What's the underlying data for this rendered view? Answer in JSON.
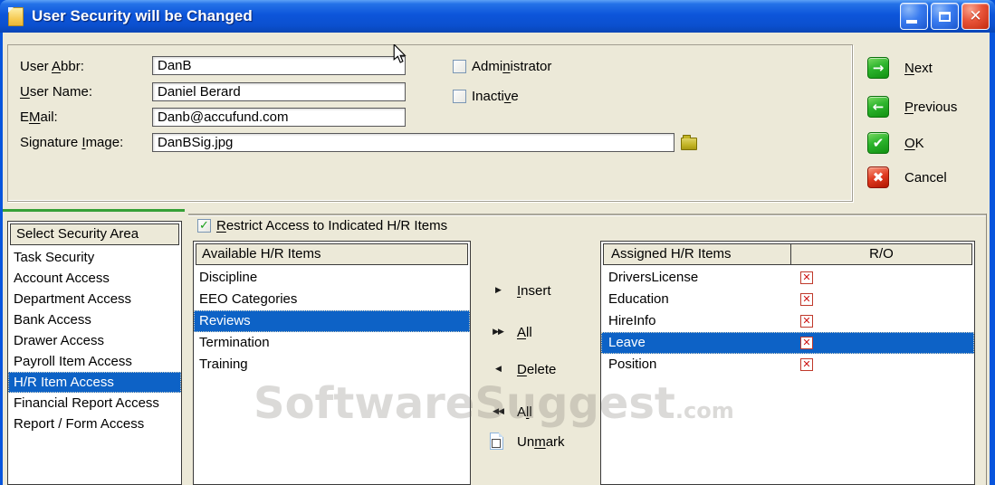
{
  "window": {
    "title": "User Security will be Changed",
    "title_icon": "document-icon",
    "controls": [
      {
        "name": "minimize",
        "icon": "minimize-icon"
      },
      {
        "name": "maximize",
        "icon": "maximize-icon"
      },
      {
        "name": "close",
        "icon": "close-icon",
        "glyph": "✕"
      }
    ]
  },
  "user_form": {
    "fields": [
      {
        "label": "User &Abbr:",
        "value": "DanB"
      },
      {
        "label": "&User Name:",
        "value": "Daniel Berard"
      },
      {
        "label": "E&Mail:",
        "value": "Danb@accufund.com"
      },
      {
        "label": "Signature &Image:",
        "value": "DanBSig.jpg",
        "browse_icon": "folder-icon"
      }
    ],
    "checkboxes": [
      {
        "label": "Admi&nistrator",
        "checked": false
      },
      {
        "label": "Inacti&ve",
        "checked": false
      }
    ]
  },
  "nav_buttons": [
    {
      "label": "&Next",
      "glyph": "→",
      "color": "#1FA51F"
    },
    {
      "label": "&Previous",
      "glyph": "←",
      "color": "#1FA51F"
    },
    {
      "label": "&OK",
      "glyph": "✔",
      "color": "#1FA51F"
    },
    {
      "label": "Cancel",
      "glyph": "✖",
      "color": "#D42A10"
    }
  ],
  "security_area_list": {
    "header": "Select Security Area",
    "items": [
      {
        "label": "Task Security"
      },
      {
        "label": "Account Access"
      },
      {
        "label": "Department Access"
      },
      {
        "label": "Bank Access"
      },
      {
        "label": "Drawer Access"
      },
      {
        "label": "Payroll Item Access"
      },
      {
        "label": "H/R Item Access",
        "selected": true
      },
      {
        "label": "Financial Report Access"
      },
      {
        "label": "Report / Form Access"
      }
    ]
  },
  "restrict_checkbox": {
    "label": "&Restrict Access to Indicated H/R Items",
    "checked": true
  },
  "available_list": {
    "header": "Available H/R Items",
    "items": [
      {
        "label": "Discipline"
      },
      {
        "label": "EEO Categories"
      },
      {
        "label": "Reviews",
        "selected": true
      },
      {
        "label": "Termination"
      },
      {
        "label": "Training"
      }
    ]
  },
  "transfer_buttons": [
    {
      "label": "&Insert",
      "glyph": "▶"
    },
    {
      "label": "&All",
      "glyph": "▶▶"
    },
    {
      "label": "&Delete",
      "glyph": "◀"
    },
    {
      "label": "A&ll",
      "glyph": "◀◀"
    },
    {
      "label": "Un&mark",
      "glyph": "",
      "icon": "unmark-page-icon"
    }
  ],
  "assigned_list": {
    "headers": [
      "Assigned H/R Items",
      "R/O"
    ],
    "rows": [
      {
        "label": "DriversLicense",
        "ro": true
      },
      {
        "label": "Education",
        "ro": true
      },
      {
        "label": "HireInfo",
        "ro": true
      },
      {
        "label": "Leave",
        "ro": true,
        "selected": true
      },
      {
        "label": "Position",
        "ro": true
      }
    ]
  },
  "watermark": {
    "text": "SoftwareSuggest",
    "suffix": ".com"
  },
  "colors": {
    "selection": "#0D62C6",
    "titlebar_blue": "#0B50CF",
    "client_bg": "#ECE9D8",
    "green_divider": "#36A036",
    "readonly_x": "#CC1111",
    "check_green": "#18A018",
    "close_red": "#E85338"
  }
}
